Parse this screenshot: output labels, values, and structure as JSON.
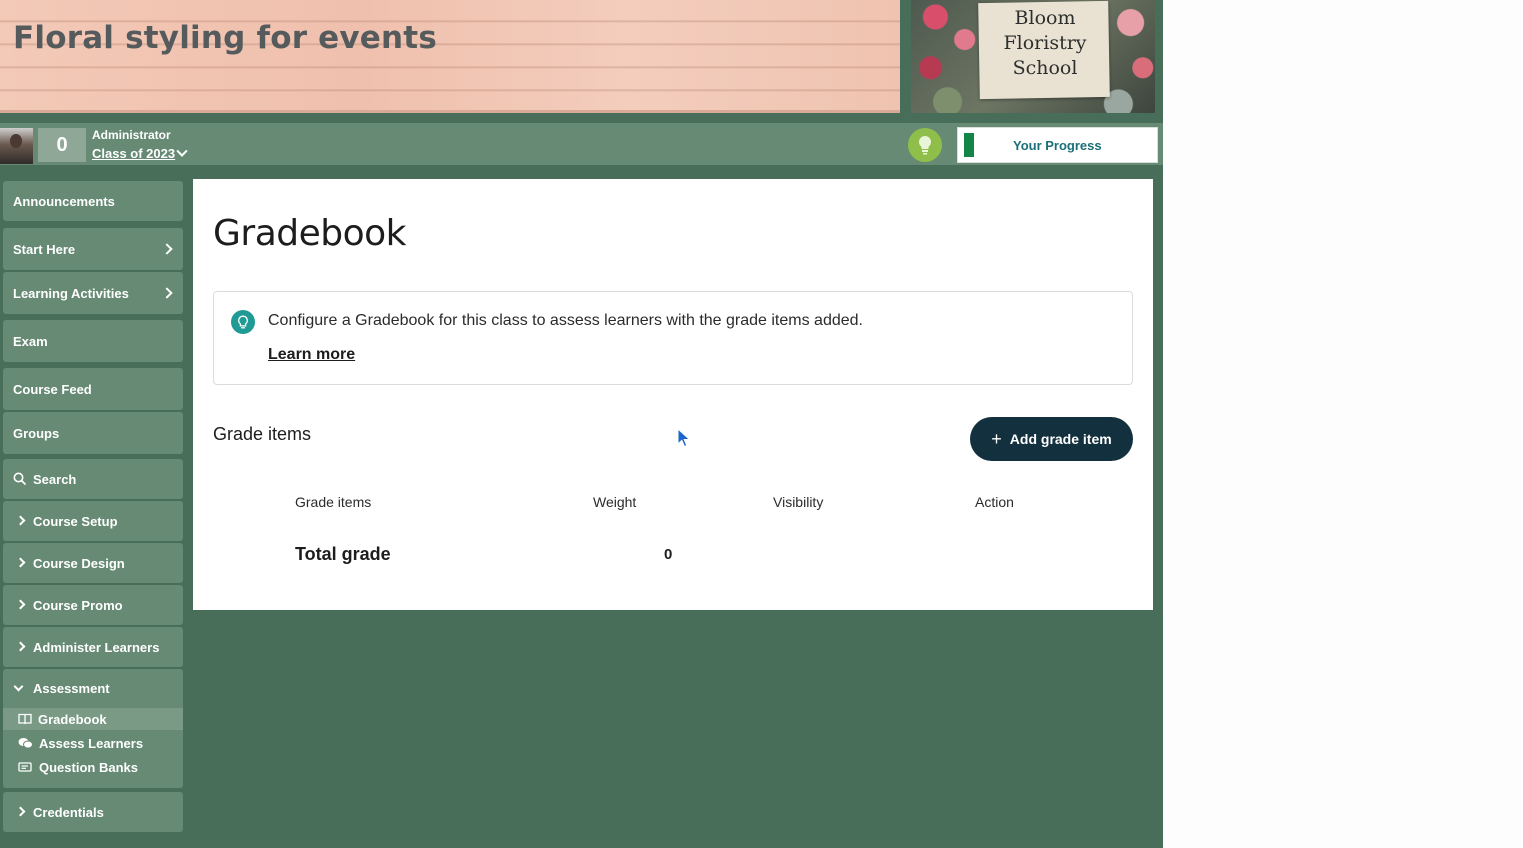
{
  "banner": {
    "title": "Floral styling for events"
  },
  "logo": {
    "text": "Bloom\nFloristry\nSchool"
  },
  "user": {
    "points": "0",
    "role": "Administrator",
    "class_name": "Class of 2023"
  },
  "progress": {
    "label": "Your Progress",
    "fraction": 0.05,
    "color": "#138546"
  },
  "sidebar": {
    "items": [
      {
        "label": "Announcements"
      },
      {
        "label": "Start Here"
      },
      {
        "label": "Learning Activities"
      },
      {
        "label": "Exam"
      },
      {
        "label": "Course Feed"
      },
      {
        "label": "Groups"
      },
      {
        "label": "Search",
        "icon": "search-icon"
      },
      {
        "label": "Course Setup"
      },
      {
        "label": "Course Design"
      },
      {
        "label": "Course Promo"
      },
      {
        "label": "Administer Learners"
      },
      {
        "label": "Assessment"
      },
      {
        "label": "Credentials"
      }
    ],
    "assessment_sub": [
      {
        "label": "Gradebook",
        "icon": "book-icon",
        "active": true
      },
      {
        "label": "Assess Learners",
        "icon": "chat-bubbles-icon"
      },
      {
        "label": "Question Banks",
        "icon": "stack-icon"
      }
    ]
  },
  "main": {
    "title": "Gradebook",
    "info": {
      "text": "Configure a Gradebook for this class to assess learners with the grade items added.",
      "link": "Learn more",
      "icon": "lightbulb-icon"
    },
    "section_title": "Grade items",
    "add_button": {
      "plus": "+",
      "label": "Add grade item"
    },
    "table": {
      "headers": [
        "Grade items",
        "Weight",
        "Visibility",
        "Action"
      ],
      "rows": [
        {
          "name": "Total grade",
          "weight": "0"
        }
      ]
    }
  },
  "colors": {
    "page_bg": "#486d59",
    "nav_item": "#668a74",
    "button_dark": "#12303e",
    "accent_teal": "#1f9a94"
  }
}
